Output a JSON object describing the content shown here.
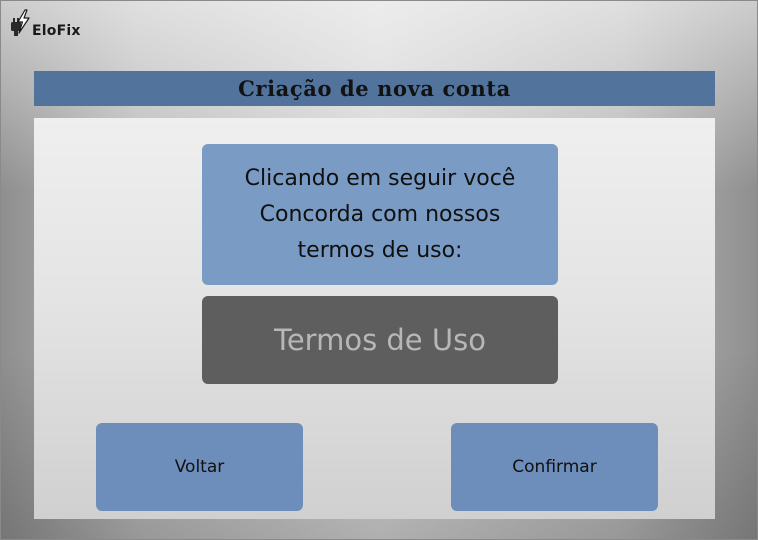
{
  "app": {
    "brand_name": "EloFix",
    "logo_icon": "lightning-plug-icon"
  },
  "header": {
    "title": "Criação de nova conta",
    "color": "#52739c"
  },
  "message": {
    "text": "Clicando em seguir você\nConcorda com nossos\ntermos de uso:",
    "color": "#7a9bc4"
  },
  "terms_button": {
    "label": "Termos de Uso",
    "color": "#5e5e5e"
  },
  "buttons": {
    "back_label": "Voltar",
    "confirm_label": "Confirmar",
    "color": "#6d8dbb"
  }
}
